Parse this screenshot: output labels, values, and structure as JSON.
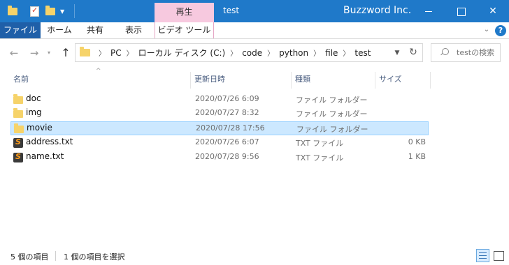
{
  "window": {
    "title": "test",
    "brand": "Buzzword Inc.",
    "context_tab_group": "再生",
    "minimize": "",
    "maximize": "",
    "close": "✕"
  },
  "ribbon": {
    "tabs": [
      "ファイル",
      "ホーム",
      "共有",
      "表示",
      "ビデオ ツール"
    ],
    "help": "?"
  },
  "nav": {
    "back": "←",
    "forward": "→",
    "recent": "▾",
    "up": "↑",
    "refresh": "↻"
  },
  "address": {
    "crumbs": [
      "PC",
      "ローカル ディスク (C:)",
      "code",
      "python",
      "file",
      "test"
    ]
  },
  "search": {
    "placeholder": "testの検索"
  },
  "columns": [
    "名前",
    "更新日時",
    "種類",
    "サイズ"
  ],
  "files": [
    {
      "name": "doc",
      "date": "2020/07/26 6:09",
      "type": "ファイル フォルダー",
      "size": "",
      "icon": "folder-icon",
      "selected": false
    },
    {
      "name": "img",
      "date": "2020/07/27 8:32",
      "type": "ファイル フォルダー",
      "size": "",
      "icon": "folder-icon",
      "selected": false
    },
    {
      "name": "movie",
      "date": "2020/07/28 17:56",
      "type": "ファイル フォルダー",
      "size": "",
      "icon": "folder-icon",
      "selected": true
    },
    {
      "name": "address.txt",
      "date": "2020/07/26 6:07",
      "type": "TXT ファイル",
      "size": "0 KB",
      "icon": "sublime-text-icon",
      "selected": false
    },
    {
      "name": "name.txt",
      "date": "2020/07/28 9:56",
      "type": "TXT ファイル",
      "size": "1 KB",
      "icon": "sublime-text-icon",
      "selected": false
    }
  ],
  "status": {
    "item_count": "5 個の項目",
    "selected_count": "1 個の項目を選択"
  },
  "colors": {
    "titlebar": "#1f79c9",
    "file_tab": "#1f5fa8",
    "context_tab": "#f7c9df",
    "selection": "#cce8ff",
    "folder": "#f6d36a"
  }
}
